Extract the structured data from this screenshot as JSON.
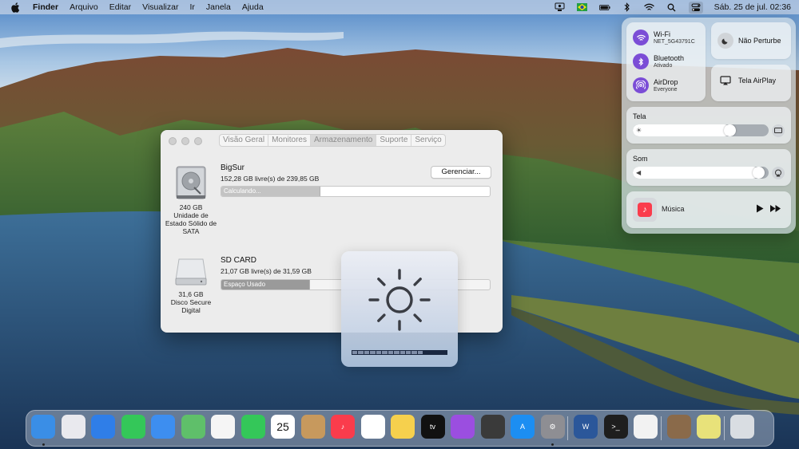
{
  "menubar": {
    "app_name": "Finder",
    "menus": [
      "Arquivo",
      "Editar",
      "Visualizar",
      "Ir",
      "Janela",
      "Ajuda"
    ],
    "clock": "Sáb. 25 de jul.  02:36",
    "icons": [
      "screen-sharing-icon",
      "brazil-flag-icon",
      "battery-icon",
      "bluetooth-icon",
      "wifi-icon",
      "spotlight-icon",
      "control-center-icon"
    ]
  },
  "about_window": {
    "tabs": [
      "Visão Geral",
      "Monitores",
      "Armazenamento",
      "Suporte",
      "Serviço"
    ],
    "active_tab": "Armazenamento",
    "disks": [
      {
        "name": "BigSur",
        "free_text": "152,28 GB livre(s) de 239,85 GB",
        "bar_label": "Calculando...",
        "used_fraction": 0.37,
        "caption": "240 GB\nUnidade de\nEstado Sólido de\nSATA",
        "manage_label": "Gerenciar..."
      },
      {
        "name": "SD CARD",
        "free_text": "21,07 GB livre(s) de 31,59 GB",
        "bar_label": "Espaço Usado",
        "used_fraction": 0.33,
        "caption": "31,6 GB\nDisco Secure\nDigital"
      }
    ]
  },
  "brightness_hud": {
    "icon": "sun-icon",
    "level_fraction": 0.75,
    "segments": 16,
    "filled_segments": 12
  },
  "control_center": {
    "wifi": {
      "label": "Wi-Fi",
      "sub": "NET_5G43791C"
    },
    "bluetooth": {
      "label": "Bluetooth",
      "sub": "Ativado"
    },
    "airdrop": {
      "label": "AirDrop",
      "sub": "Everyone"
    },
    "dnd": {
      "label": "Não Perturbe"
    },
    "airplay": {
      "label": "Tela AirPlay"
    },
    "display": {
      "label": "Tela",
      "level_fraction": 0.72
    },
    "sound": {
      "label": "Som",
      "level_fraction": 0.93
    },
    "music": {
      "label": "Música"
    },
    "accent": "#7b4dd6"
  },
  "dock": {
    "items": [
      {
        "name": "finder",
        "glyph": "",
        "color": "#3a8ee6",
        "dot": true
      },
      {
        "name": "launchpad",
        "glyph": "",
        "color": "#e9e9ee",
        "dot": false
      },
      {
        "name": "safari",
        "glyph": "",
        "color": "#2f7ee8",
        "dot": false
      },
      {
        "name": "messages",
        "glyph": "",
        "color": "#34c759",
        "dot": false
      },
      {
        "name": "mail",
        "glyph": "",
        "color": "#3d8ef0",
        "dot": false
      },
      {
        "name": "maps",
        "glyph": "",
        "color": "#5fbf6a",
        "dot": false
      },
      {
        "name": "photos",
        "glyph": "",
        "color": "#f5f5f5",
        "dot": false
      },
      {
        "name": "facetime",
        "glyph": "",
        "color": "#34c759",
        "dot": false
      },
      {
        "name": "calendar",
        "glyph": "25",
        "color": "#ffffff",
        "dot": false
      },
      {
        "name": "contacts",
        "glyph": "",
        "color": "#c7995d",
        "dot": false
      },
      {
        "name": "music",
        "glyph": "♪",
        "color": "#fa3c4c",
        "dot": false
      },
      {
        "name": "reminders",
        "glyph": "",
        "color": "#ffffff",
        "dot": false
      },
      {
        "name": "notes",
        "glyph": "",
        "color": "#f6d04d",
        "dot": false
      },
      {
        "name": "apple-tv",
        "glyph": "tv",
        "color": "#111111",
        "dot": false
      },
      {
        "name": "podcasts",
        "glyph": "",
        "color": "#9b4ee0",
        "dot": false
      },
      {
        "name": "final-cut-pro",
        "glyph": "",
        "color": "#3a3a3a",
        "dot": false
      },
      {
        "name": "app-store",
        "glyph": "A",
        "color": "#1c8ef2",
        "dot": false
      },
      {
        "name": "system-preferences",
        "glyph": "⚙",
        "color": "#8e8e93",
        "dot": true
      },
      {
        "name": "word",
        "glyph": "W",
        "color": "#2b579a",
        "dot": false
      },
      {
        "name": "terminal",
        "glyph": ">_",
        "color": "#1e1e1e",
        "dot": false
      },
      {
        "name": "textedit",
        "glyph": "",
        "color": "#f2f2f2",
        "dot": false
      },
      {
        "name": "photo-stack",
        "glyph": "",
        "color": "#8a6a4a",
        "dot": false
      },
      {
        "name": "stickies-doc",
        "glyph": "",
        "color": "#e8e27a",
        "dot": false
      },
      {
        "name": "trash",
        "glyph": "",
        "color": "#d9dde2",
        "dot": false
      }
    ]
  }
}
